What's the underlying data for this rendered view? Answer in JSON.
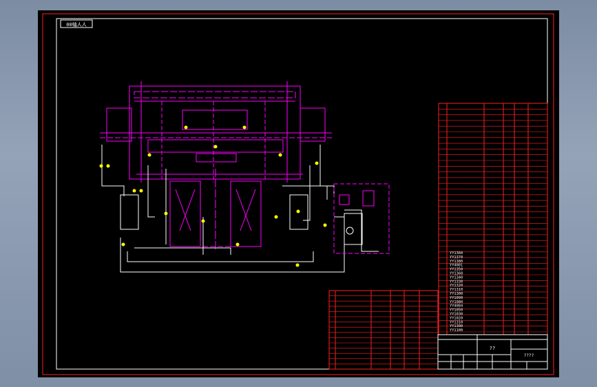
{
  "drawing": {
    "view_label": "00轴人人",
    "title_block": {
      "drawing_name": "??",
      "drawing_code": "????"
    }
  },
  "bom_right": {
    "codes": [
      "YY1360",
      "YY1370",
      "YY1380",
      "YY4001",
      "YY1350",
      "YY1360",
      "YY1340",
      "YY1330",
      "YY1320",
      "YY1310",
      "YY1300",
      "YY1090",
      "YY1080",
      "YY4004",
      "YY1050",
      "YY1030",
      "YY1020",
      "YY1310",
      "YY1300",
      "YY1100"
    ]
  },
  "colors": {
    "background": "#000000",
    "frame": "#ff2020",
    "piping": "#ffffff",
    "machine": "#ff00ff",
    "table_text": "#00ff00",
    "marker": "#ffff00"
  }
}
